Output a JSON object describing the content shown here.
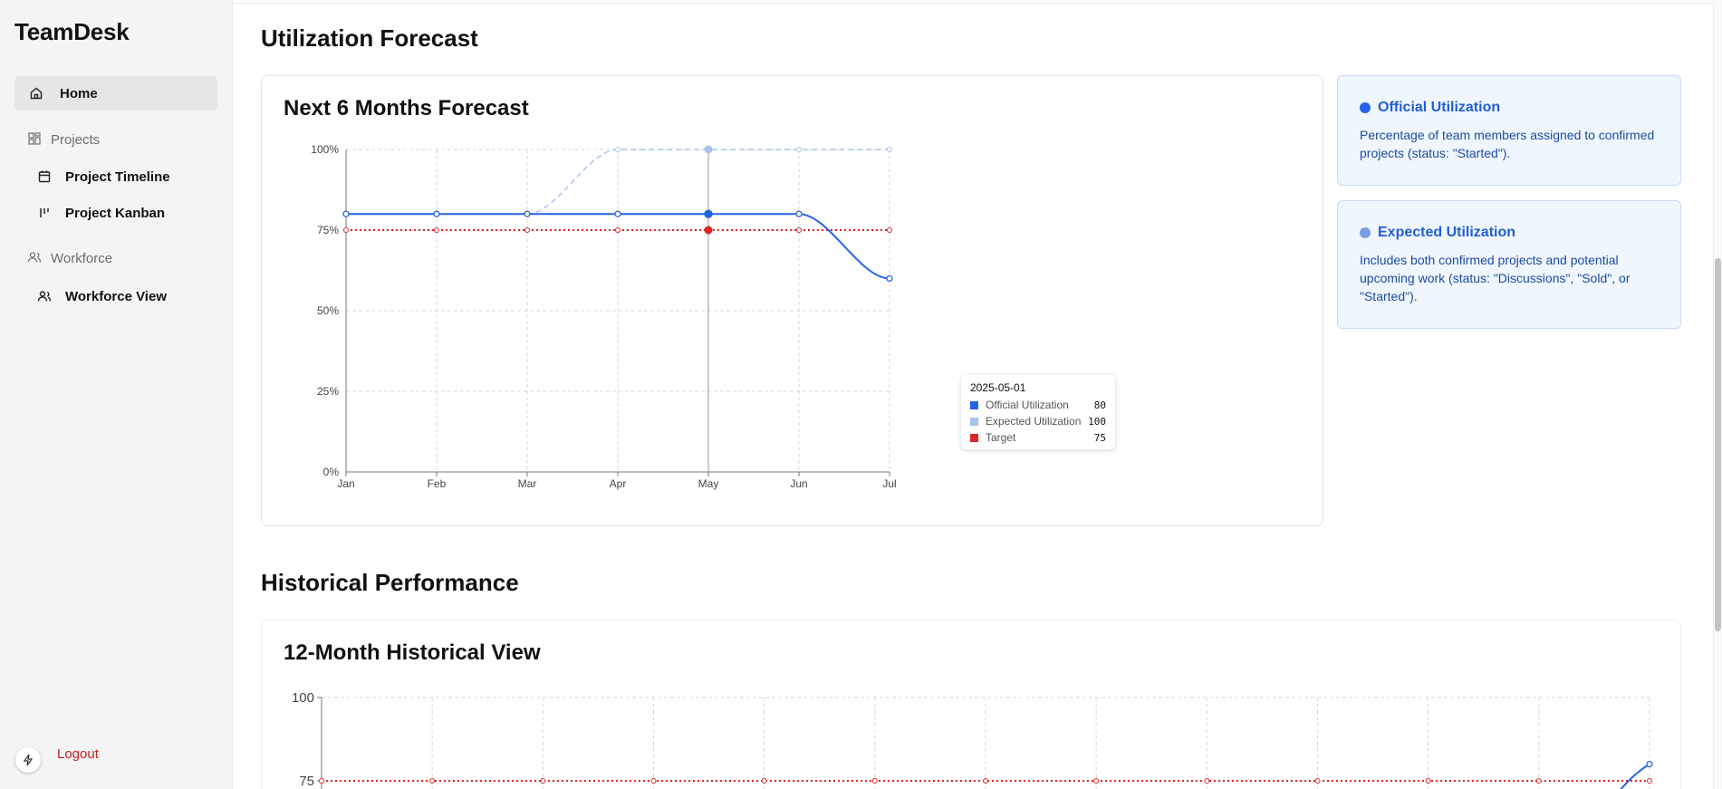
{
  "app": {
    "brand": "TeamDesk"
  },
  "sidebar": {
    "home": {
      "label": "Home",
      "icon": "home-icon"
    },
    "projects_group": {
      "label": "Projects",
      "icon": "grid-icon"
    },
    "project_timeline": {
      "label": "Project Timeline",
      "icon": "calendar-icon"
    },
    "project_kanban": {
      "label": "Project Kanban",
      "icon": "kanban-icon"
    },
    "workforce_group": {
      "label": "Workforce",
      "icon": "users-icon"
    },
    "workforce_view": {
      "label": "Workforce View",
      "icon": "users-icon"
    },
    "logout": {
      "label": "Logout",
      "icon": "bolt-icon"
    }
  },
  "sections": {
    "forecast_heading": "Utilization Forecast",
    "forecast_card_title": "Next 6 Months Forecast",
    "historical_heading": "Historical Performance",
    "historical_card_title": "12-Month Historical View"
  },
  "info_cards": {
    "official": {
      "title": "Official Utilization",
      "text": "Percentage of team members assigned to confirmed projects (status: \"Started\").",
      "color": "#2563eb"
    },
    "expected": {
      "title": "Expected Utilization",
      "text": "Includes both confirmed projects and potential upcoming work (status: \"Discussions\", \"Sold\", or \"Started\").",
      "color": "#7b9de6"
    }
  },
  "tooltip": {
    "date": "2025-05-01",
    "rows": [
      {
        "label": "Official Utilization",
        "value": "80",
        "color": "#2563eb"
      },
      {
        "label": "Expected Utilization",
        "value": "100",
        "color": "#a9c2ee"
      },
      {
        "label": "Target",
        "value": "75",
        "color": "#dc2626"
      }
    ]
  },
  "chart_data": [
    {
      "type": "line",
      "title": "Next 6 Months Forecast",
      "x": [
        "Jan",
        "Feb",
        "Mar",
        "Apr",
        "May",
        "Jun",
        "Jul"
      ],
      "y_ticks": [
        "0%",
        "25%",
        "50%",
        "75%",
        "100%"
      ],
      "ylim": [
        0,
        100
      ],
      "grid": true,
      "series": [
        {
          "name": "Official Utilization",
          "values": [
            80,
            80,
            80,
            80,
            80,
            80,
            60
          ],
          "color": "#2563eb"
        },
        {
          "name": "Expected Utilization",
          "values": [
            80,
            80,
            80,
            100,
            100,
            100,
            100
          ],
          "color": "#a9c2ee"
        },
        {
          "name": "Target",
          "values": [
            75,
            75,
            75,
            75,
            75,
            75,
            75
          ],
          "color": "#dc2626"
        }
      ],
      "highlight_index": 4
    },
    {
      "type": "line",
      "title": "12-Month Historical View",
      "y_ticks_visible": [
        "100",
        "75"
      ],
      "ylim": [
        0,
        100
      ],
      "grid": true,
      "series": [
        {
          "name": "Target",
          "values": [
            75,
            75,
            75,
            75,
            75,
            75,
            75,
            75,
            75,
            75,
            75,
            75
          ],
          "color": "#dc2626"
        },
        {
          "name": "Official Utilization",
          "values": [
            null,
            null,
            null,
            null,
            null,
            null,
            null,
            null,
            null,
            null,
            null,
            80
          ],
          "color": "#2563eb"
        }
      ]
    }
  ]
}
